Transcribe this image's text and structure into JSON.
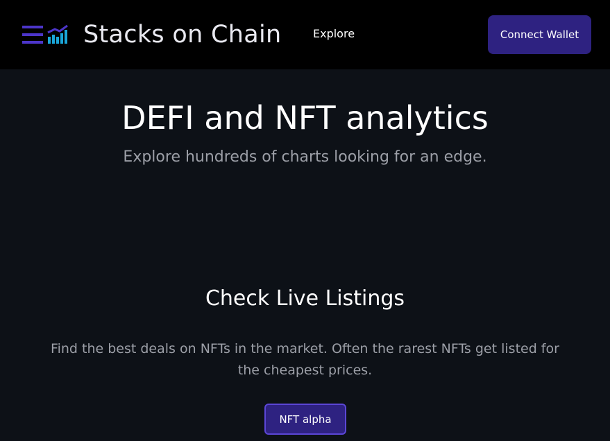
{
  "header": {
    "brand_name": "Stacks on Chain",
    "nav": {
      "explore_label": "Explore"
    },
    "connect_wallet_label": "Connect Wallet",
    "logo_icon": "menu-chart-icon"
  },
  "hero": {
    "title": "DEFI and NFT analytics",
    "subtitle": "Explore hundreds of charts looking for an edge."
  },
  "listings": {
    "title": "Check Live Listings",
    "description": "Find the best deals on NFTs in the market. Often the rarest NFTs get listed for the cheapest prices.",
    "button_label": "NFT alpha"
  },
  "colors": {
    "header_bg": "#000000",
    "page_bg": "#0d1117",
    "button_bg": "#2e2281",
    "button_border": "#5b46d6",
    "logo_purple": "#4c35c9",
    "logo_cyan": "#1aa6d9",
    "muted_text": "#9c9fa7"
  }
}
